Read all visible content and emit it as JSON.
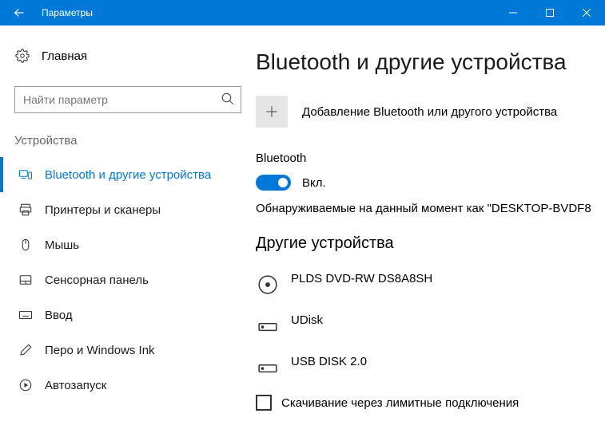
{
  "window": {
    "title": "Параметры"
  },
  "sidebar": {
    "home": "Главная",
    "search_placeholder": "Найти параметр",
    "category": "Устройства",
    "items": [
      {
        "label": "Bluetooth и другие устройства",
        "active": true
      },
      {
        "label": "Принтеры и сканеры"
      },
      {
        "label": "Мышь"
      },
      {
        "label": "Сенсорная панель"
      },
      {
        "label": "Ввод"
      },
      {
        "label": "Перо и Windows Ink"
      },
      {
        "label": "Автозапуск"
      }
    ]
  },
  "main": {
    "title": "Bluetooth и другие устройства",
    "add_device": "Добавление Bluetooth или другого устройства",
    "bluetooth_label": "Bluetooth",
    "toggle_state": "Вкл.",
    "discoverable": "Обнаруживаемые на данный момент как \"DESKTOP-BVDF8",
    "other_heading": "Другие устройства",
    "devices": [
      {
        "name": "PLDS DVD-RW DS8A8SH"
      },
      {
        "name": "UDisk"
      },
      {
        "name": "USB DISK 2.0"
      }
    ],
    "metered_label": "Скачивание через лимитные подключения"
  }
}
